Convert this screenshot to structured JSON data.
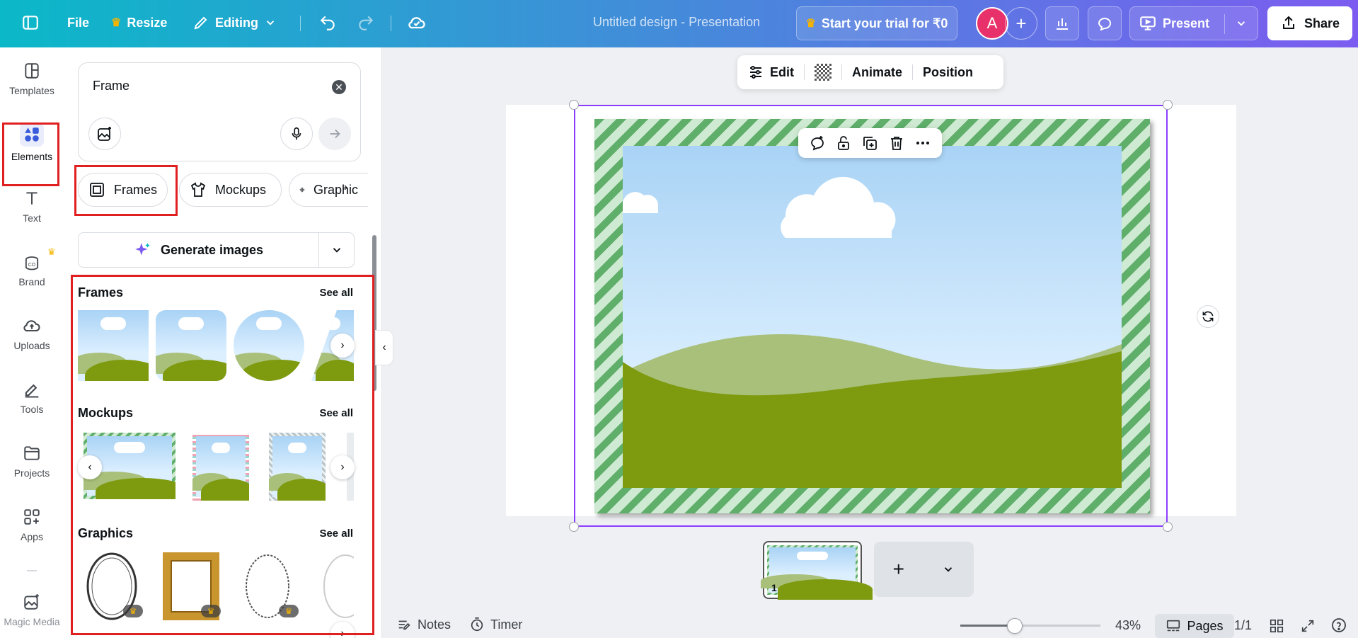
{
  "topbar": {
    "file_label": "File",
    "resize_label": "Resize",
    "editing_label": "Editing",
    "document_title": "Untitled design - Presentation",
    "trial_label": "Start your trial for ₹0",
    "avatar_letter": "A",
    "present_label": "Present",
    "share_label": "Share",
    "gradient_start": "#0bb8c8",
    "gradient_end": "#7c5cf0"
  },
  "rail": {
    "items": [
      {
        "label": "Templates",
        "icon": "templates-icon"
      },
      {
        "label": "Elements",
        "icon": "elements-icon"
      },
      {
        "label": "Text",
        "icon": "text-icon"
      },
      {
        "label": "Brand",
        "icon": "brand-icon"
      },
      {
        "label": "Uploads",
        "icon": "uploads-icon"
      },
      {
        "label": "Tools",
        "icon": "tools-icon"
      },
      {
        "label": "Projects",
        "icon": "projects-icon"
      },
      {
        "label": "Apps",
        "icon": "apps-icon"
      },
      {
        "label": "Magic Media",
        "icon": "magic-media-icon"
      }
    ],
    "active": "Elements"
  },
  "panel": {
    "search_value": "Frame",
    "chips": [
      {
        "label": "Frames",
        "icon": "frame-icon"
      },
      {
        "label": "Mockups",
        "icon": "tshirt-icon"
      },
      {
        "label": "Graphic",
        "icon": "flower-icon"
      }
    ],
    "generate_label": "Generate images",
    "sections": [
      {
        "title": "Frames",
        "see_all": "See all"
      },
      {
        "title": "Mockups",
        "see_all": "See all"
      },
      {
        "title": "Graphics",
        "see_all": "See all"
      }
    ],
    "crown": "♛"
  },
  "canvas": {
    "toolbar": {
      "edit_label": "Edit",
      "animate_label": "Animate",
      "position_label": "Position"
    },
    "selection_color": "#8b3dff",
    "frame_colors": {
      "stripe_dark": "#5fae6a",
      "stripe_light": "#cfead2"
    },
    "sky_color": "#a9d3f5",
    "hill_color": "#7e9a0f"
  },
  "pages": {
    "thumb_number": "1",
    "add_symbol": "+"
  },
  "bottom": {
    "notes_label": "Notes",
    "timer_label": "Timer",
    "zoom_percent": "43%",
    "zoom_value": 43,
    "pages_label": "Pages",
    "page_count": "1/1"
  }
}
